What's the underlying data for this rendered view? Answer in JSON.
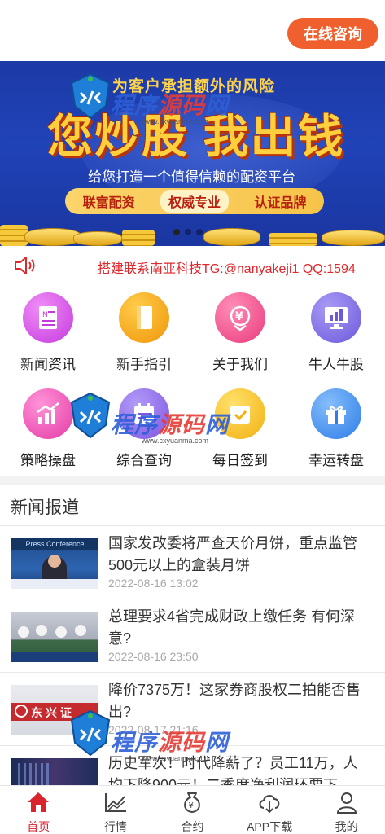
{
  "header": {
    "consult_label": "在线咨询"
  },
  "banner": {
    "tagline": "为客户承担额外的风险",
    "headline": "您炒股 我出钱",
    "subline": "给您打造一个值得信赖的配资平台",
    "pills": [
      "联富配资",
      "权威专业",
      "认证品牌"
    ],
    "slide_count": 3,
    "active_slide": 0,
    "colors": {
      "background": "#1d3aa6",
      "headline": "#ffcf3d",
      "tagline": "#ffd34a"
    }
  },
  "notice": {
    "icon": "speaker-icon",
    "text": "搭建联系南亚科技TG:@nanyakeji1 QQ:1594"
  },
  "menu": [
    {
      "label": "新闻资讯",
      "icon": "news-doc-icon",
      "color": "#d24be6"
    },
    {
      "label": "新手指引",
      "icon": "book-icon",
      "color": "#f5a20f"
    },
    {
      "label": "关于我们",
      "icon": "yen-badge-icon",
      "color": "#f04b8b"
    },
    {
      "label": "牛人牛股",
      "icon": "chart-monitor-icon",
      "color": "#7c6ce6"
    },
    {
      "label": "策略操盘",
      "icon": "rising-bars-icon",
      "color": "#ee4fb6"
    },
    {
      "label": "综合查询",
      "icon": "calendar-query-icon",
      "color": "#8a63e8"
    },
    {
      "label": "每日签到",
      "icon": "checkin-icon",
      "color": "#f6c12a"
    },
    {
      "label": "幸运转盘",
      "icon": "gift-icon",
      "color": "#3c8ff0"
    }
  ],
  "news_section": {
    "title": "新闻报道",
    "items": [
      {
        "title": "国家发改委将严查天价月饼，重点监管500元以上的盒装月饼",
        "time": "2022-08-16 13:02",
        "thumb_caption": "Press Conference"
      },
      {
        "title": "总理要求4省完成财政上缴任务 有何深意?",
        "time": "2022-08-16 23:50",
        "thumb_caption": ""
      },
      {
        "title": "降价7375万！这家券商股权二拍能否售出?",
        "time": "2022-08-17 21:16",
        "thumb_caption": "东兴证"
      },
      {
        "title": "历史军次！时代降薪了？员工11万，人均下降900元！二季度净利润环要下",
        "time": "",
        "thumb_caption": ""
      }
    ]
  },
  "watermark": {
    "text_blue": "程序",
    "text_red": "源码",
    "text_blue2": "网",
    "url": "www.cxyuanma.com"
  },
  "tabbar": [
    {
      "label": "首页",
      "icon": "home-icon",
      "active": true
    },
    {
      "label": "行情",
      "icon": "market-chart-icon",
      "active": false
    },
    {
      "label": "合约",
      "icon": "money-bag-icon",
      "active": false
    },
    {
      "label": "APP下载",
      "icon": "cloud-download-icon",
      "active": false
    },
    {
      "label": "我的",
      "icon": "user-icon",
      "active": false
    }
  ]
}
